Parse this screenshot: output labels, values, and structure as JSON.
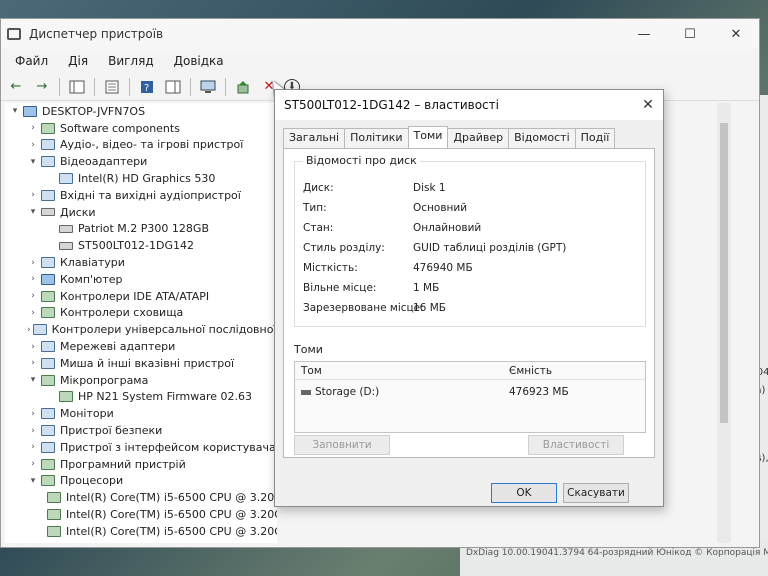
{
  "main_window": {
    "title": "Диспетчер пристроїв",
    "controls": {
      "minimize": "—",
      "maximize": "☐",
      "close": "✕"
    }
  },
  "menu": [
    "Файл",
    "Дія",
    "Вигляд",
    "Довідка"
  ],
  "toolbar": {
    "back": "←",
    "forward": "→",
    "remove": "✕",
    "download": "⬇"
  },
  "tree": [
    {
      "exp": "▾",
      "indent": 0,
      "icon": "pc",
      "label": "DESKTOP-JVFN7OS"
    },
    {
      "exp": "›",
      "indent": 1,
      "icon": "chip",
      "label": "Software components"
    },
    {
      "exp": "›",
      "indent": 1,
      "icon": "audio",
      "label": "Аудіо-, відео- та ігрові пристрої"
    },
    {
      "exp": "▾",
      "indent": 1,
      "icon": "monitor",
      "label": "Відеоадаптери"
    },
    {
      "exp": "",
      "indent": 2,
      "icon": "monitor",
      "label": "Intel(R) HD Graphics 530"
    },
    {
      "exp": "›",
      "indent": 1,
      "icon": "audio",
      "label": "Вхідні та вихідні аудіопристрої"
    },
    {
      "exp": "▾",
      "indent": 1,
      "icon": "disk",
      "label": "Диски"
    },
    {
      "exp": "",
      "indent": 2,
      "icon": "disk",
      "label": "Patriot M.2 P300 128GB"
    },
    {
      "exp": "",
      "indent": 2,
      "icon": "disk",
      "label": "ST500LT012-1DG142"
    },
    {
      "exp": "›",
      "indent": 1,
      "icon": "keyboard",
      "label": "Клавіатури"
    },
    {
      "exp": "›",
      "indent": 1,
      "icon": "pc",
      "label": "Комп'ютер"
    },
    {
      "exp": "›",
      "indent": 1,
      "icon": "chip",
      "label": "Контролери IDE ATA/ATAPI"
    },
    {
      "exp": "›",
      "indent": 1,
      "icon": "chip",
      "label": "Контролери сховища"
    },
    {
      "exp": "›",
      "indent": 1,
      "icon": "usb",
      "label": "Контролери універсальної послідовної шини"
    },
    {
      "exp": "›",
      "indent": 1,
      "icon": "network",
      "label": "Мережеві адаптери"
    },
    {
      "exp": "›",
      "indent": 1,
      "icon": "mouse",
      "label": "Миша й інші вказівні пристрої"
    },
    {
      "exp": "▾",
      "indent": 1,
      "icon": "chip",
      "label": "Мікропрограма"
    },
    {
      "exp": "",
      "indent": 2,
      "icon": "chip",
      "label": "HP N21 System Firmware 02.63"
    },
    {
      "exp": "›",
      "indent": 1,
      "icon": "monitor",
      "label": "Монітори"
    },
    {
      "exp": "›",
      "indent": 1,
      "icon": "security",
      "label": "Пристрої безпеки"
    },
    {
      "exp": "›",
      "indent": 1,
      "icon": "hid",
      "label": "Пристрої з інтерфейсом користувача"
    },
    {
      "exp": "›",
      "indent": 1,
      "icon": "chip",
      "label": "Програмний пристрій"
    },
    {
      "exp": "▾",
      "indent": 1,
      "icon": "cpu",
      "label": "Процесори"
    },
    {
      "exp": "",
      "indent": 2,
      "icon": "cpu",
      "label": "Intel(R) Core(TM) i5-6500 CPU @ 3.20GHz"
    },
    {
      "exp": "",
      "indent": 2,
      "icon": "cpu",
      "label": "Intel(R) Core(TM) i5-6500 CPU @ 3.20GHz"
    },
    {
      "exp": "",
      "indent": 2,
      "icon": "cpu",
      "label": "Intel(R) Core(TM) i5-6500 CPU @ 3.20GHz"
    }
  ],
  "dialog": {
    "title": "ST500LT012-1DG142 – властивості",
    "close": "✕",
    "tabs": [
      "Загальні",
      "Політики",
      "Томи",
      "Драйвер",
      "Відомості",
      "Події"
    ],
    "active_tab": 2,
    "group_label": "Відомості про диск",
    "props": [
      {
        "label": "Диск:",
        "value": "Disk 1"
      },
      {
        "label": "Тип:",
        "value": "Основний"
      },
      {
        "label": "Стан:",
        "value": "Онлайновий"
      },
      {
        "label": "Стиль розділу:",
        "value": "GUID таблиці розділів (GPT)"
      },
      {
        "label": "Місткість:",
        "value": "476940 МБ"
      },
      {
        "label": "Вільне місце:",
        "value": "1 МБ"
      },
      {
        "label": "Зарезервоване місце:",
        "value": "16 МБ"
      }
    ],
    "volumes_label": "Томи",
    "volumes_header": {
      "volume": "Том",
      "capacity": "Ємність"
    },
    "volumes": [
      {
        "volume": "Storage (D:)",
        "capacity": "476923 МБ"
      }
    ],
    "populate_button": "Заповнити",
    "properties_button": "Властивості",
    "ok_button": "OK",
    "cancel_button": "Скасувати"
  },
  "background": {
    "right_texts": [
      "1904",
      "ська)",
      "CPUs),"
    ],
    "bottom_text": "DxDiag 10.00.19041.3794 64-розрядний Юнікод © Корпорація Майкро"
  }
}
